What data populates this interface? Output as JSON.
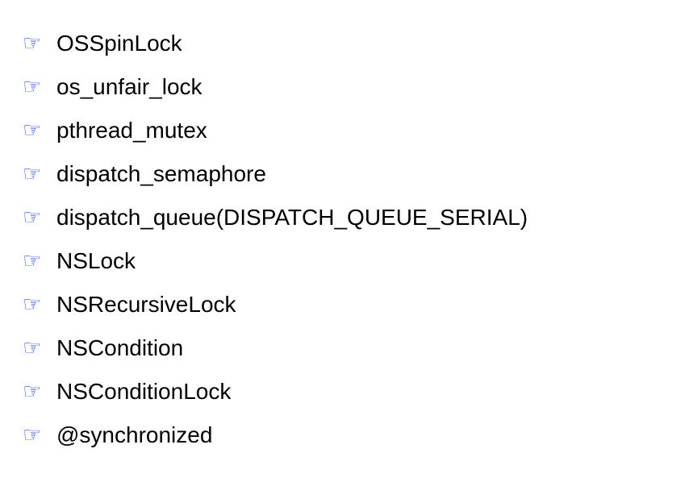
{
  "bullet_icon": {
    "name": "pointing-hand-icon",
    "glyph": "☞",
    "color": "#2b4cf5"
  },
  "items": [
    "OSSpinLock",
    "os_unfair_lock",
    "pthread_mutex",
    "dispatch_semaphore",
    "dispatch_queue(DISPATCH_QUEUE_SERIAL)",
    "NSLock",
    "NSRecursiveLock",
    "NSCondition",
    "NSConditionLock",
    "@synchronized"
  ]
}
